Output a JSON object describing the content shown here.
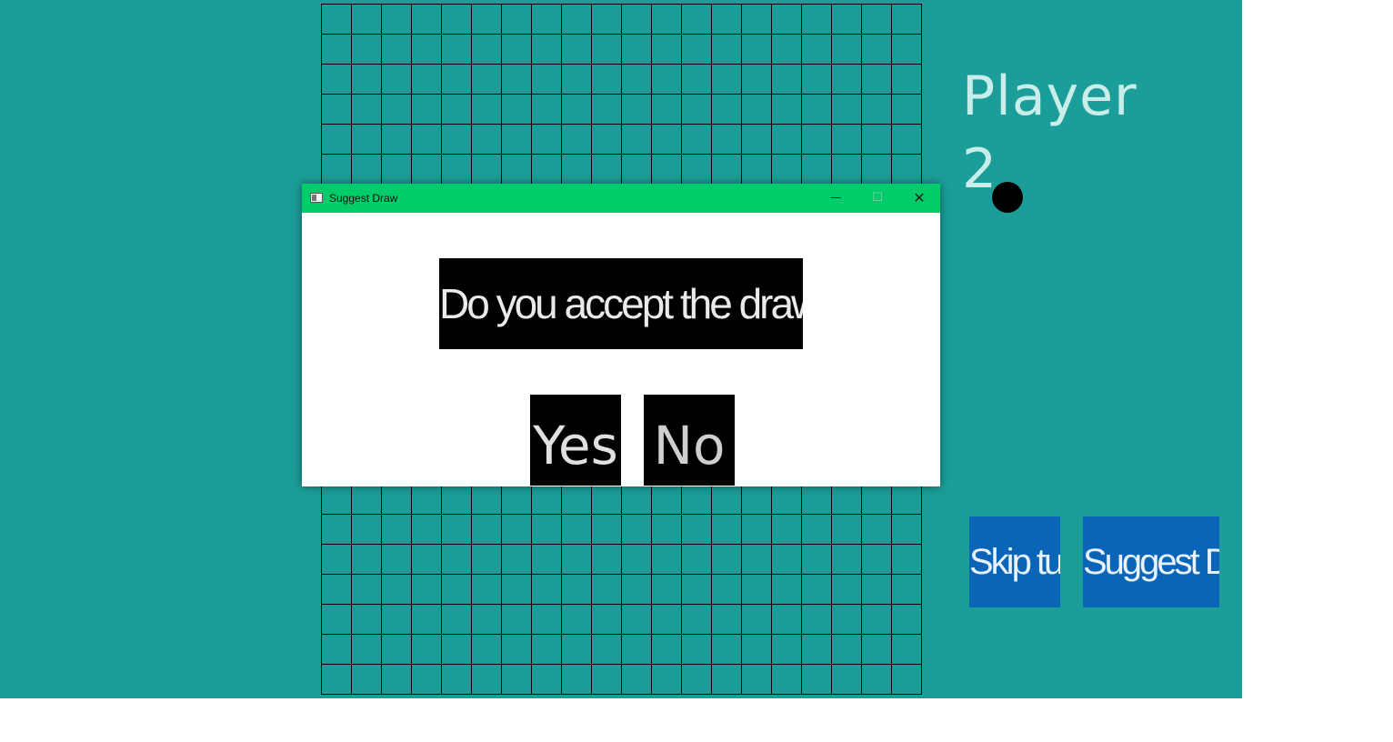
{
  "game": {
    "player_label": "Player 2",
    "current_stone_color": "#000000",
    "skip_label": "Skip turn",
    "suggest_draw_label": "Suggest Draw",
    "background_color": "#1b9e99"
  },
  "board": {
    "columns": 20,
    "rows": 23
  },
  "dialog": {
    "title": "Suggest Draw",
    "title_bar_color": "#00cc6a",
    "prompt": "Do you accept the draw?",
    "yes_label": "Yes",
    "no_label": "No",
    "minimize_glyph": "—",
    "maximize_glyph": "☐",
    "close_glyph": "✕"
  }
}
